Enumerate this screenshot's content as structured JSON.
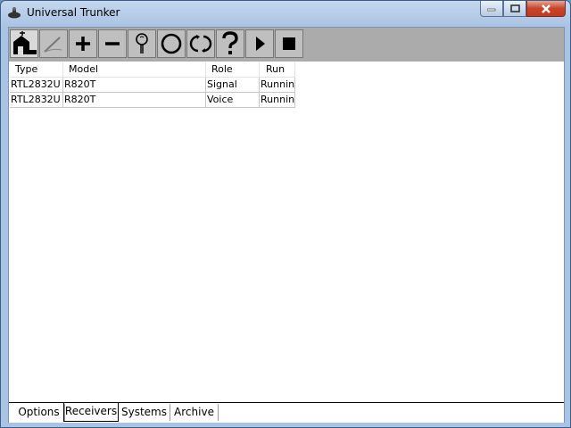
{
  "window": {
    "title": "Universal Trunker"
  },
  "toolbar": {
    "buttons": [
      {
        "name": "home-scanner",
        "icon": "home-antenna-icon"
      },
      {
        "name": "edit",
        "icon": "pen-icon"
      },
      {
        "name": "add",
        "icon": "plus-icon"
      },
      {
        "name": "remove",
        "icon": "minus-icon"
      },
      {
        "name": "probe",
        "icon": "probe-icon"
      },
      {
        "name": "circle",
        "icon": "circle-icon"
      },
      {
        "name": "refresh",
        "icon": "refresh-icon"
      },
      {
        "name": "help",
        "icon": "question-icon"
      },
      {
        "name": "start",
        "icon": "play-icon"
      },
      {
        "name": "stop",
        "icon": "stop-icon"
      }
    ]
  },
  "receivers": {
    "columns": [
      "Type",
      "Model",
      "Role",
      "Run"
    ],
    "rows": [
      {
        "type": "RTL2832U",
        "model": "R820T",
        "role": "Signal",
        "run": "Running"
      },
      {
        "type": "RTL2832U",
        "model": "R820T",
        "role": "Voice",
        "run": "Running"
      }
    ]
  },
  "tabs": [
    "Options",
    "Receivers",
    "Systems",
    "Archive"
  ],
  "selected_tab": "Receivers"
}
